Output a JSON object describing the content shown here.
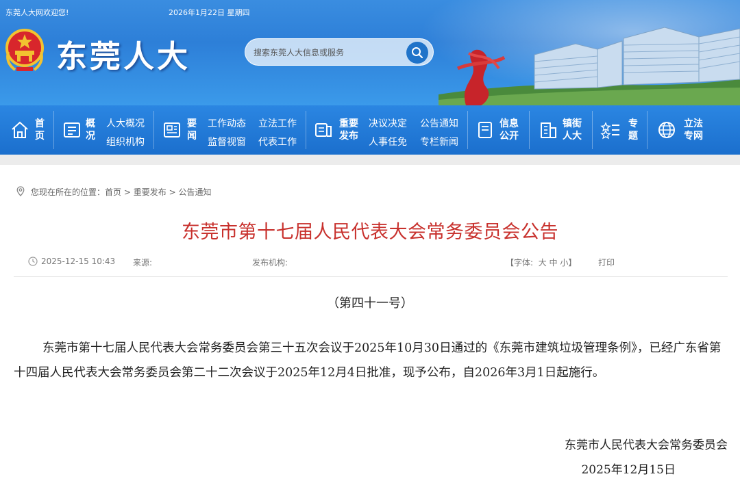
{
  "header": {
    "welcome": "东莞人大网欢迎您!",
    "date": "2026年1月22日 星期四",
    "site_title": "东莞人大",
    "search_placeholder": "搜索东莞人大信息或服务"
  },
  "nav": {
    "home": [
      "首",
      "页"
    ],
    "overview": [
      "概",
      "况"
    ],
    "overview_links": [
      "人大概况",
      "组织机构"
    ],
    "news": [
      "要",
      "闻"
    ],
    "news_links": [
      "工作动态",
      "立法工作",
      "监督视窗",
      "代表工作"
    ],
    "release": [
      "重要",
      "发布"
    ],
    "release_links": [
      "决议决定",
      "公告通知",
      "人事任免",
      "专栏新闻"
    ],
    "info": [
      "信息",
      "公开"
    ],
    "town": [
      "镇街",
      "人大"
    ],
    "topic": [
      "专",
      "题"
    ],
    "legislation": [
      "立法",
      "专网"
    ]
  },
  "breadcrumb": {
    "prefix": "您现在所在的位置：",
    "items": [
      "首页",
      "重要发布",
      "公告通知"
    ],
    "sep": ">"
  },
  "article": {
    "title": "东莞市第十七届人民代表大会常务委员会公告",
    "datetime": "2025-12-15 10:43",
    "source_label": "来源:",
    "publisher_label": "发布机构:",
    "font_label": "【字体:",
    "font_large": "大",
    "font_medium": "中",
    "font_small": "小",
    "font_close": "】",
    "print": "打印",
    "doc_number": "（第四十一号）",
    "body": "东莞市第十七届人民代表大会常务委员会第三十五次会议于2025年10月30日通过的《东莞市建筑垃圾管理条例》，已经广东省第十四届人民代表大会常务委员会第二十二次会议于2025年12月4日批准，现予公布，自2026年3月1日起施行。",
    "signature_org": "东莞市人民代表大会常务委员会",
    "signature_date": "2025年12月15日"
  },
  "colors": {
    "banner": "#2d7fd8",
    "nav": "#1b6fcd",
    "title_red": "#c8312d"
  }
}
